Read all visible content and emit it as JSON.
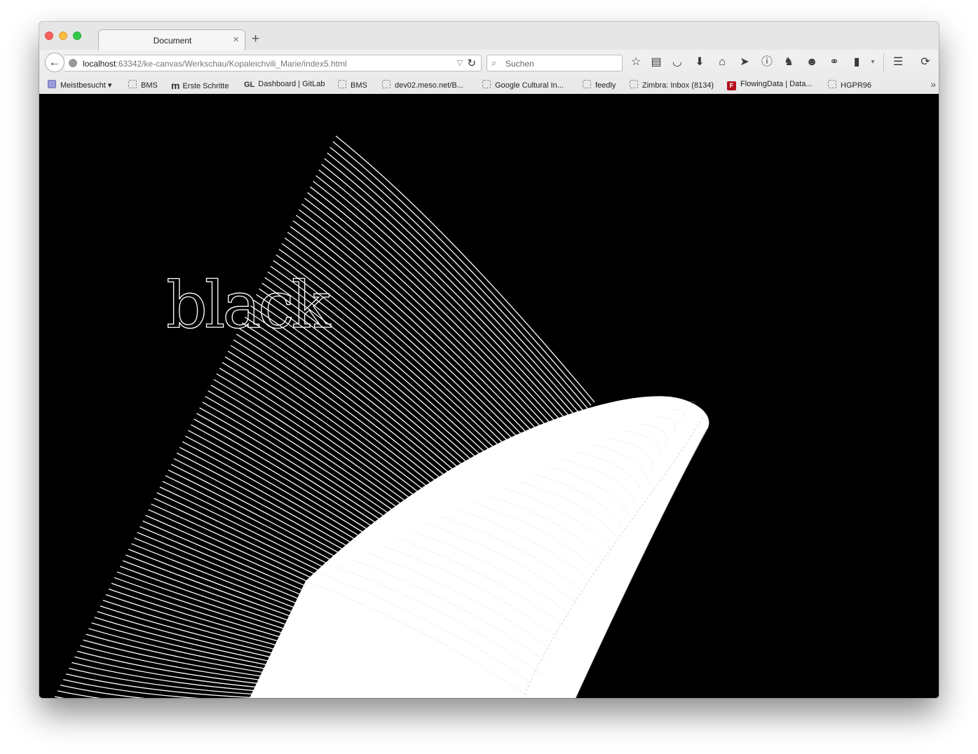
{
  "window": {
    "tab_title": "Document",
    "tab_close": "×",
    "new_tab": "+"
  },
  "navbar": {
    "back": "←",
    "url_host": "localhost",
    "url_rest": ":63342/ke-canvas/Werkschau/Kopaleichvili_Marie/index5.html",
    "url_dropmarker": "▽",
    "reload": "↻",
    "search_placeholder": "Suchen",
    "search_icon": "⌕",
    "toolbar_icons": [
      {
        "name": "bookmark-star-icon",
        "glyph": "☆"
      },
      {
        "name": "reading-list-icon",
        "glyph": "▤"
      },
      {
        "name": "pocket-icon",
        "glyph": "◡"
      },
      {
        "name": "download-icon",
        "glyph": "⬇"
      },
      {
        "name": "home-icon",
        "glyph": "⌂"
      },
      {
        "name": "send-icon",
        "glyph": "➤"
      },
      {
        "name": "info-icon",
        "glyph": "ⓘ"
      },
      {
        "name": "extension-icon",
        "glyph": "♞"
      },
      {
        "name": "smiley-icon",
        "glyph": "☻"
      },
      {
        "name": "share-icon",
        "glyph": "⚭"
      },
      {
        "name": "clipboard-icon",
        "glyph": "▮"
      },
      {
        "name": "clipboard-dropdown-icon",
        "glyph": "▾"
      },
      {
        "name": "menu-icon",
        "glyph": "☰"
      },
      {
        "name": "sync-icon",
        "glyph": "⟳"
      }
    ]
  },
  "bookmarks": [
    {
      "label": "Meistbesucht ▾",
      "icon": "folder"
    },
    {
      "label": "BMS",
      "icon": "page"
    },
    {
      "label": "Erste Schritte",
      "icon": "m"
    },
    {
      "label": "Dashboard | GitLab",
      "icon": "gl"
    },
    {
      "label": "BMS",
      "icon": "page"
    },
    {
      "label": "dev02.meso.net/B...",
      "icon": "page"
    },
    {
      "label": "Google Cultural In...",
      "icon": "page"
    },
    {
      "label": "feedly",
      "icon": "page"
    },
    {
      "label": "Zimbra: Inbox (8134)",
      "icon": "page"
    },
    {
      "label": "FlowingData | Data...",
      "icon": "f"
    },
    {
      "label": "HGPR96",
      "icon": "page"
    }
  ],
  "bookmarks_overflow": "»",
  "canvas": {
    "word": "black",
    "background": "#000000",
    "stroke_color": "#ffffff"
  }
}
